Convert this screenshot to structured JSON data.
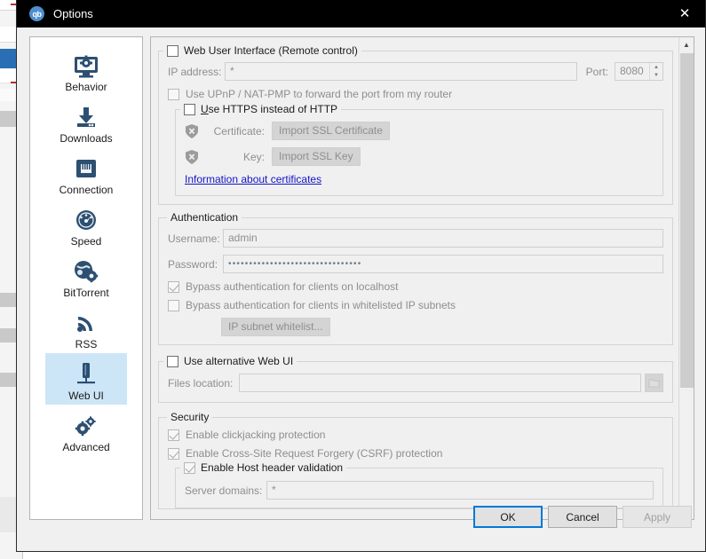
{
  "window": {
    "title": "Options",
    "logo_text": "qb",
    "close_icon": "✕"
  },
  "sidebar": {
    "items": [
      {
        "label": "Behavior",
        "icon": "monitor-gear-icon",
        "selected": false
      },
      {
        "label": "Downloads",
        "icon": "download-arrow-icon",
        "selected": false
      },
      {
        "label": "Connection",
        "icon": "network-port-icon",
        "selected": false
      },
      {
        "label": "Speed",
        "icon": "speedometer-icon",
        "selected": false
      },
      {
        "label": "BitTorrent",
        "icon": "globe-gear-icon",
        "selected": false
      },
      {
        "label": "RSS",
        "icon": "rss-feed-icon",
        "selected": false
      },
      {
        "label": "Web UI",
        "icon": "server-icon",
        "selected": true
      },
      {
        "label": "Advanced",
        "icon": "gears-icon",
        "selected": false
      }
    ],
    "selection_color": "#cde6f7"
  },
  "main": {
    "web_ui_group": {
      "title": "Web User Interface (Remote control)",
      "checked": false,
      "ip_label": "IP address:",
      "ip_value": "*",
      "port_label": "Port:",
      "port_value": "8080",
      "upnp_label": "Use UPnP / NAT-PMP to forward the port from my router",
      "upnp_checked": false
    },
    "https_group": {
      "title": "Use HTTPS instead of HTTP",
      "title_mnemonic": "U",
      "title_rest": "se HTTPS instead of HTTP",
      "checked": false,
      "certificate_label": "Certificate:",
      "certificate_button": "Import SSL Certificate",
      "certificate_status_icon": "shield-invalid-icon",
      "key_label": "Key:",
      "key_button": "Import SSL Key",
      "key_status_icon": "shield-invalid-icon",
      "info_link": "Information about certificates"
    },
    "authentication_group": {
      "title": "Authentication",
      "username_label": "Username:",
      "username_value": "admin",
      "password_label": "Password:",
      "password_value": "••••••••••••••••••••••••••••••••",
      "bypass_localhost_label": "Bypass authentication for clients on localhost",
      "bypass_localhost_checked": true,
      "bypass_subnets_label": "Bypass authentication for clients in whitelisted IP subnets",
      "bypass_subnets_checked": false,
      "subnet_whitelist_button": "IP subnet whitelist..."
    },
    "alt_webui_group": {
      "title": "Use alternative Web UI",
      "checked": false,
      "files_location_label": "Files location:",
      "files_location_value": "",
      "browse_icon": "folder-icon"
    },
    "security_group": {
      "title": "Security",
      "clickjacking_label": "Enable clickjacking protection",
      "clickjacking_checked": true,
      "csrf_label": "Enable Cross-Site Request Forgery (CSRF) protection",
      "csrf_checked": true,
      "host_header_label": "Enable Host header validation",
      "host_header_checked": true,
      "server_domains_label": "Server domains:",
      "server_domains_value": "*"
    }
  },
  "scrollbar": {
    "up_arrow": "▲",
    "down_arrow": "▼"
  },
  "buttons": {
    "ok": "OK",
    "cancel": "Cancel",
    "apply": "Apply"
  }
}
